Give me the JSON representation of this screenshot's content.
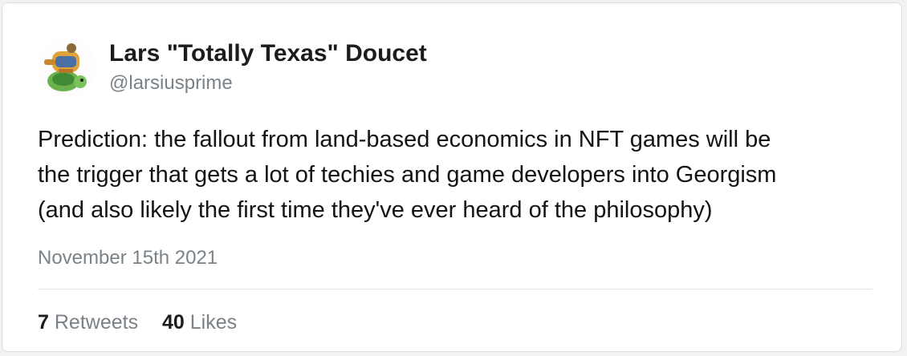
{
  "author": {
    "name": "Lars \"Totally Texas\" Doucet",
    "handle": "@larsiusprime"
  },
  "tweet": {
    "lines": [
      "Prediction: the fallout from land-based economics in NFT games will be",
      "the trigger that gets a lot of techies and game developers into Georgism",
      "(and also likely the first time they've ever heard of the philosophy)"
    ],
    "date": "November 15th 2021"
  },
  "stats": {
    "retweets_count": "7",
    "retweets_label": "Retweets",
    "likes_count": "40",
    "likes_label": "Likes"
  },
  "avatar": {
    "icon": "turtle-avatar-icon"
  }
}
